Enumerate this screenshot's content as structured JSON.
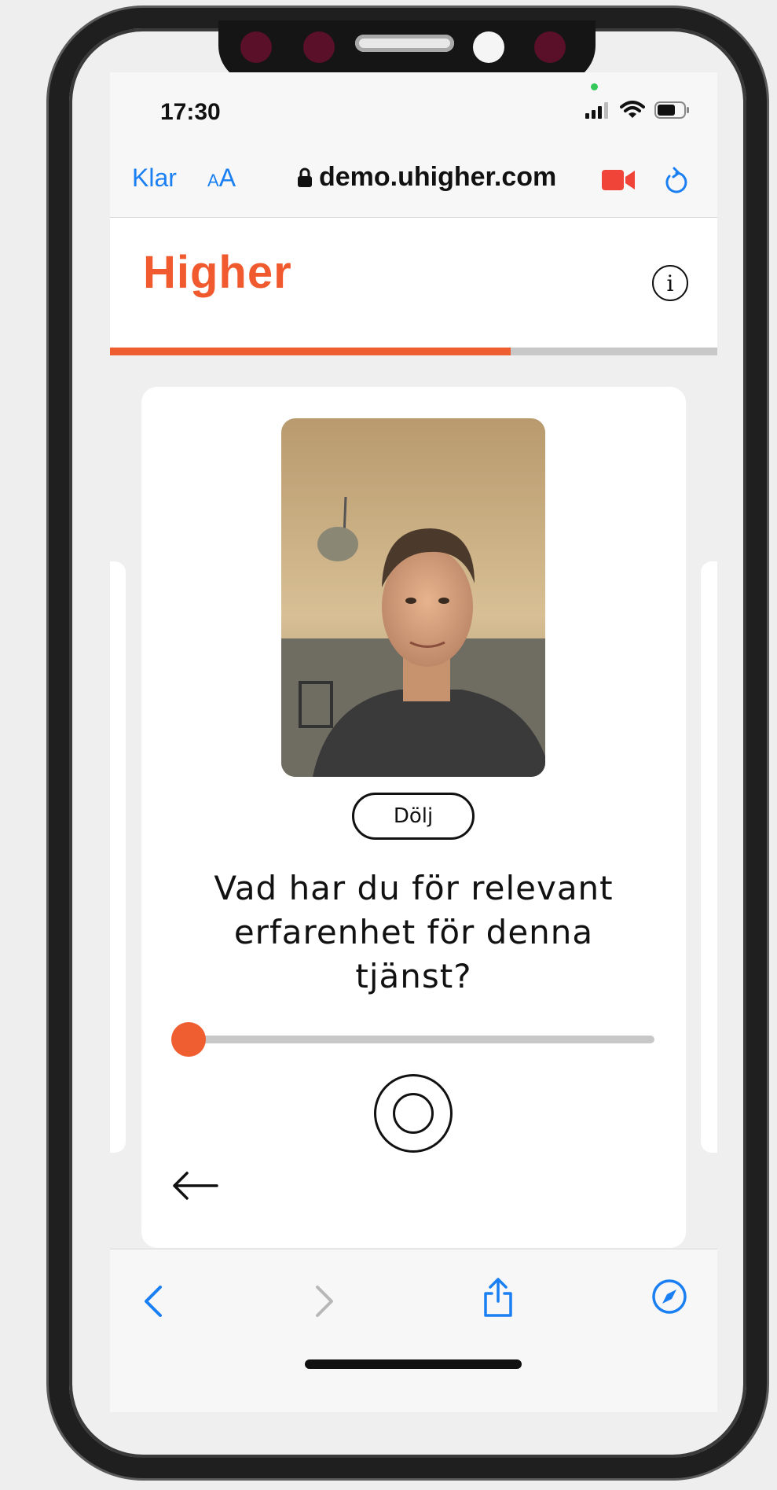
{
  "status": {
    "time": "17:30",
    "signal_icon": "cellular-signal-icon",
    "wifi_icon": "wifi-icon",
    "battery_icon": "battery-icon"
  },
  "browser": {
    "done_label": "Klar",
    "text_size_label_small": "A",
    "text_size_label_large": "A",
    "url": "demo.uhigher.com",
    "lock_icon": "lock-icon",
    "camera_icon": "video-camera-icon",
    "reload_icon": "reload-icon"
  },
  "app": {
    "logo": "Higher",
    "info_icon_text": "i",
    "progress_fraction": 0.66,
    "accent_color": "#ef5e31"
  },
  "card": {
    "hide_button": "Dölj",
    "question": "Vad har du för relevant erfarenhet för denna tjänst?",
    "slider_value": 0
  },
  "toolbar": {
    "back_icon": "chevron-left-icon",
    "forward_icon": "chevron-right-icon",
    "share_icon": "share-icon",
    "compass_icon": "compass-icon"
  }
}
